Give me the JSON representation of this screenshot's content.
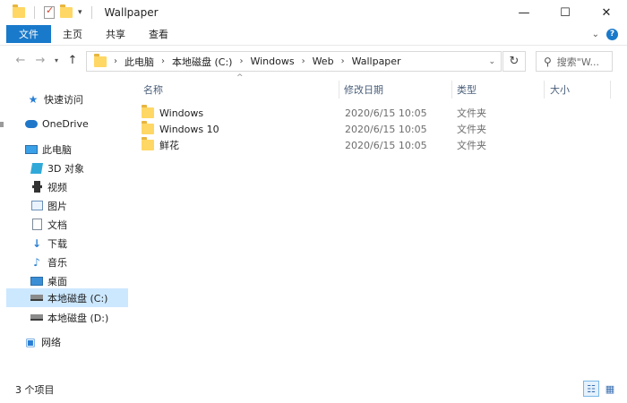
{
  "window": {
    "title": "Wallpaper",
    "minimize_glyph": "—",
    "maximize_glyph": "☐",
    "close_glyph": "✕"
  },
  "ribbon": {
    "tabs": [
      "文件",
      "主页",
      "共享",
      "查看"
    ],
    "expand_glyph": "⌄",
    "help_glyph": "?"
  },
  "nav": {
    "back_glyph": "←",
    "forward_glyph": "→",
    "recent_glyph": "▾",
    "up_glyph": "↑"
  },
  "address": {
    "breadcrumbs": [
      "此电脑",
      "本地磁盘 (C:)",
      "Windows",
      "Web",
      "Wallpaper"
    ],
    "separator": "›",
    "dropdown_glyph": "⌄",
    "refresh_glyph": "↻"
  },
  "search": {
    "placeholder": "搜索\"W...",
    "icon_glyph": "⚲"
  },
  "sidebar": {
    "items": [
      {
        "label": "快速访问",
        "icon": "star-icon"
      },
      {
        "label": "OneDrive",
        "icon": "cloud-icon"
      },
      {
        "label": "此电脑",
        "icon": "computer-icon"
      },
      {
        "label": "3D 对象",
        "icon": "3d-objects-icon"
      },
      {
        "label": "视频",
        "icon": "video-icon"
      },
      {
        "label": "图片",
        "icon": "pictures-icon"
      },
      {
        "label": "文档",
        "icon": "documents-icon"
      },
      {
        "label": "下载",
        "icon": "download-icon"
      },
      {
        "label": "音乐",
        "icon": "music-icon"
      },
      {
        "label": "桌面",
        "icon": "desktop-icon"
      },
      {
        "label": "本地磁盘 (C:)",
        "icon": "drive-icon",
        "selected": true
      },
      {
        "label": "本地磁盘 (D:)",
        "icon": "drive-icon"
      },
      {
        "label": "网络",
        "icon": "network-icon"
      }
    ]
  },
  "columns": {
    "name": "名称",
    "date": "修改日期",
    "type": "类型",
    "size": "大小",
    "sort_glyph": "^"
  },
  "files": [
    {
      "name": "Windows",
      "date": "2020/6/15 10:05",
      "type": "文件夹"
    },
    {
      "name": "Windows 10",
      "date": "2020/6/15 10:05",
      "type": "文件夹"
    },
    {
      "name": "鲜花",
      "date": "2020/6/15 10:05",
      "type": "文件夹"
    }
  ],
  "status": {
    "count": "3 个项目"
  },
  "colors": {
    "accent": "#1979ca",
    "selection": "#cce8ff",
    "folder": "#ffd764"
  }
}
